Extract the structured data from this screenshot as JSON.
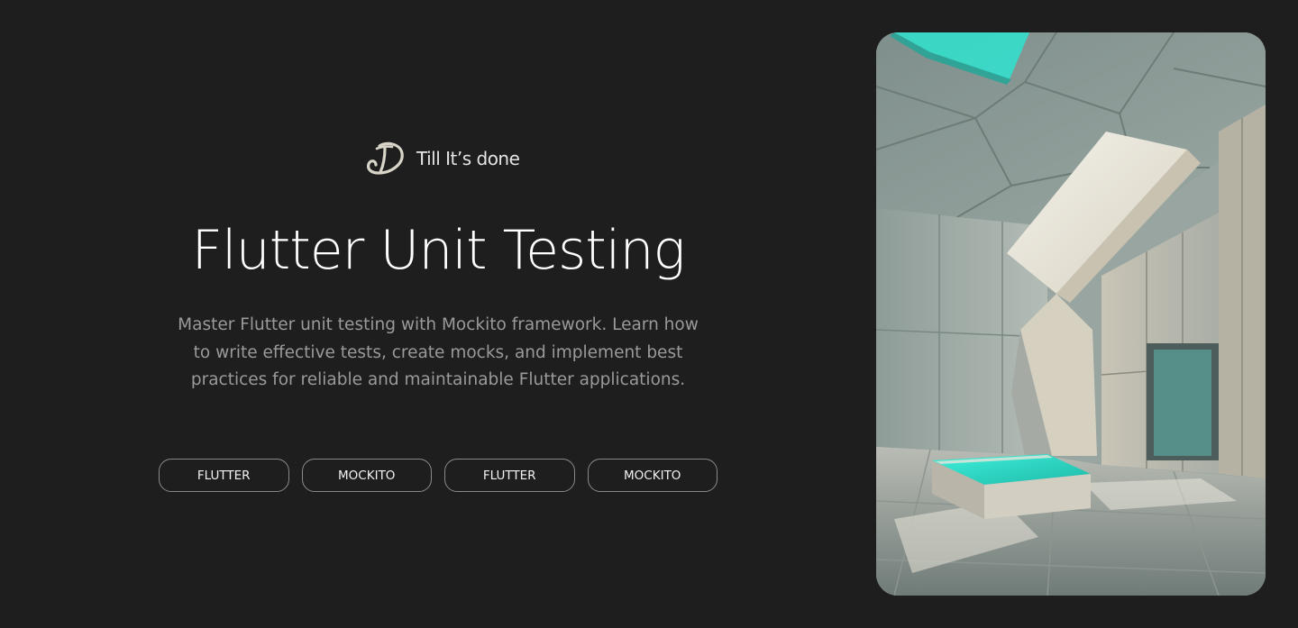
{
  "brand": {
    "logo_icon": "cursive-d-logo-icon",
    "name": "Till It’s done"
  },
  "hero": {
    "title": "Flutter Unit Testing",
    "description": "Master Flutter unit testing with Mockito framework. Learn how to write effective tests, create mocks, and implement best practices for reliable and maintainable Flutter applications."
  },
  "tags": [
    {
      "label": "FLUTTER"
    },
    {
      "label": "MOCKITO"
    },
    {
      "label": "FLUTTER"
    },
    {
      "label": "MOCKITO"
    }
  ],
  "image": {
    "subject": "concrete-architecture-photo",
    "accent_color": "#22e0cc"
  },
  "colors": {
    "background": "#1e1e1e",
    "title": "#ffffff",
    "description": "#9a9a9a",
    "tag_border": "#8a8a8a"
  }
}
